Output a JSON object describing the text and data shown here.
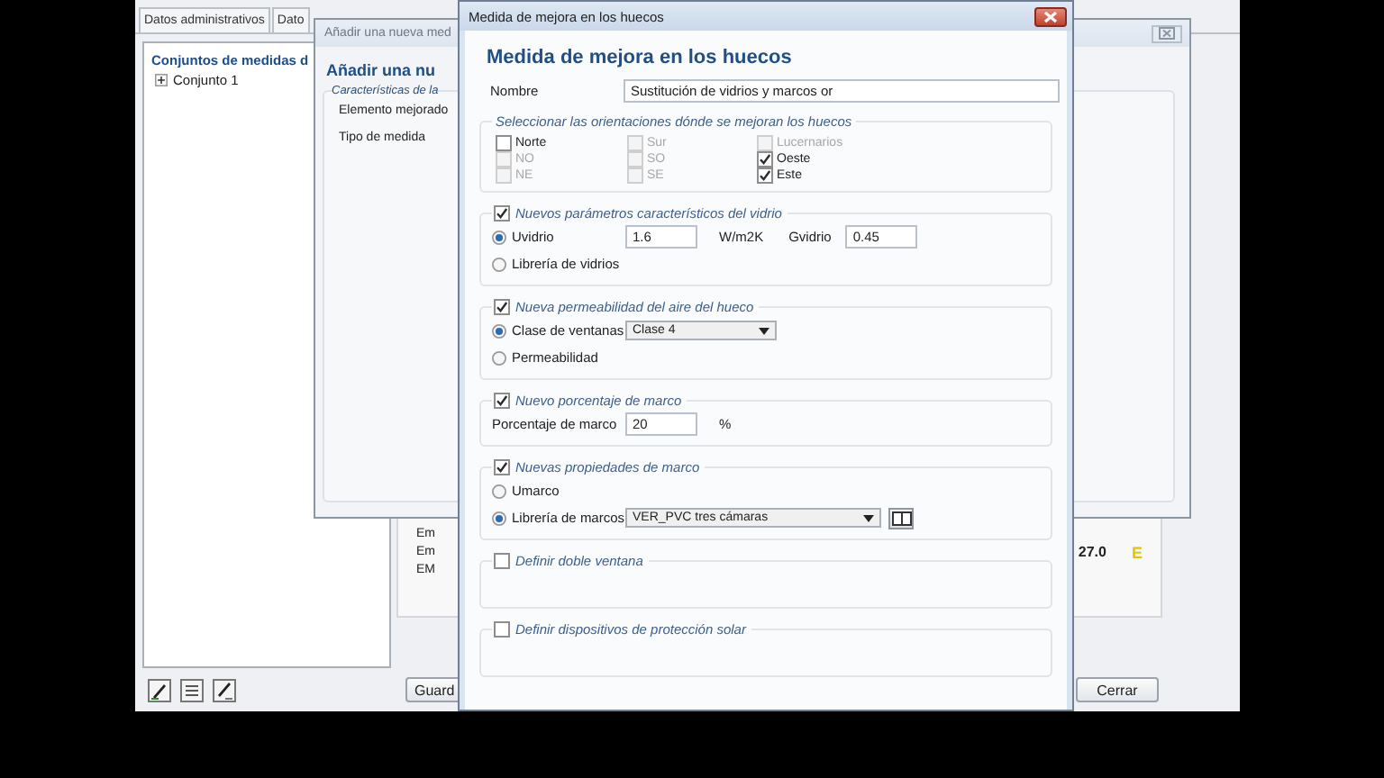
{
  "app": {
    "tabs": [
      {
        "label": "Datos administrativos",
        "selected": false
      },
      {
        "label": "Dato",
        "selected": false
      }
    ],
    "tree": {
      "title": "Conjuntos de medidas d",
      "items": [
        {
          "label": "Conjunto 1",
          "expanded": false
        }
      ]
    },
    "results": {
      "rows": [
        "Em",
        "Em",
        "EM"
      ],
      "value": "27.0",
      "grade": "E"
    },
    "buttons": [
      "Guard",
      "Cerrar"
    ]
  },
  "add_dialog": {
    "title": "Añadir una nueva med",
    "heading": "Añadir una nu",
    "group_title": "Características de la",
    "fields": [
      "Elemento mejorado",
      "Tipo de medida"
    ]
  },
  "dialog": {
    "title": "Medida de mejora en los huecos",
    "heading": "Medida de mejora en los huecos",
    "name": {
      "label": "Nombre",
      "value": "Sustitución de vidrios y marcos or"
    },
    "orientations": {
      "title": "Seleccionar las orientaciones dónde se mejoran los huecos",
      "items": [
        {
          "label": "Norte",
          "checked": false,
          "disabled": false
        },
        {
          "label": "Sur",
          "checked": false,
          "disabled": true
        },
        {
          "label": "Lucernarios",
          "checked": false,
          "disabled": true
        },
        {
          "label": "NO",
          "checked": false,
          "disabled": true
        },
        {
          "label": "SO",
          "checked": false,
          "disabled": true
        },
        {
          "label": "Oeste",
          "checked": true,
          "disabled": false
        },
        {
          "label": "NE",
          "checked": false,
          "disabled": true
        },
        {
          "label": "SE",
          "checked": false,
          "disabled": true
        },
        {
          "label": "Este",
          "checked": true,
          "disabled": false
        }
      ]
    },
    "sections": [
      {
        "label": "Nuevos parámetros característicos del vidrio",
        "checked": true,
        "rows": [
          {
            "kind": "radio",
            "label": "Uvidrio",
            "selected": true,
            "controls": [
              {
                "kind": "input",
                "value": "1.6"
              },
              {
                "kind": "text",
                "text": "W/m2K"
              },
              {
                "kind": "text",
                "text": "Gvidrio"
              },
              {
                "kind": "input",
                "value": "0.45"
              }
            ]
          },
          {
            "kind": "radio",
            "label": "Librería de vidrios",
            "selected": false
          }
        ]
      },
      {
        "label": "Nueva permeabilidad del aire del hueco",
        "checked": true,
        "rows": [
          {
            "kind": "radio",
            "label": "Clase de ventanas",
            "selected": true,
            "controls": [
              {
                "kind": "select",
                "value": "Clase 4",
                "wide": false
              }
            ]
          },
          {
            "kind": "radio",
            "label": "Permeabilidad",
            "selected": false
          }
        ]
      },
      {
        "label": "Nuevo porcentaje de marco",
        "checked": true,
        "rows": [
          {
            "kind": "label",
            "label": "Porcentaje de marco",
            "controls": [
              {
                "kind": "input",
                "value": "20"
              },
              {
                "kind": "text",
                "text": "%"
              }
            ]
          }
        ]
      },
      {
        "label": "Nuevas propiedades de marco",
        "checked": true,
        "rows": [
          {
            "kind": "radio",
            "label": "Umarco",
            "selected": false
          },
          {
            "kind": "radio",
            "label": "Librería de marcos",
            "selected": true,
            "controls": [
              {
                "kind": "select",
                "value": "VER_PVC tres cámaras",
                "wide": true
              },
              {
                "kind": "library-button"
              }
            ]
          }
        ]
      },
      {
        "label": "Definir doble ventana",
        "checked": false
      },
      {
        "label": "Definir dispositivos de protección solar",
        "checked": false
      }
    ]
  }
}
